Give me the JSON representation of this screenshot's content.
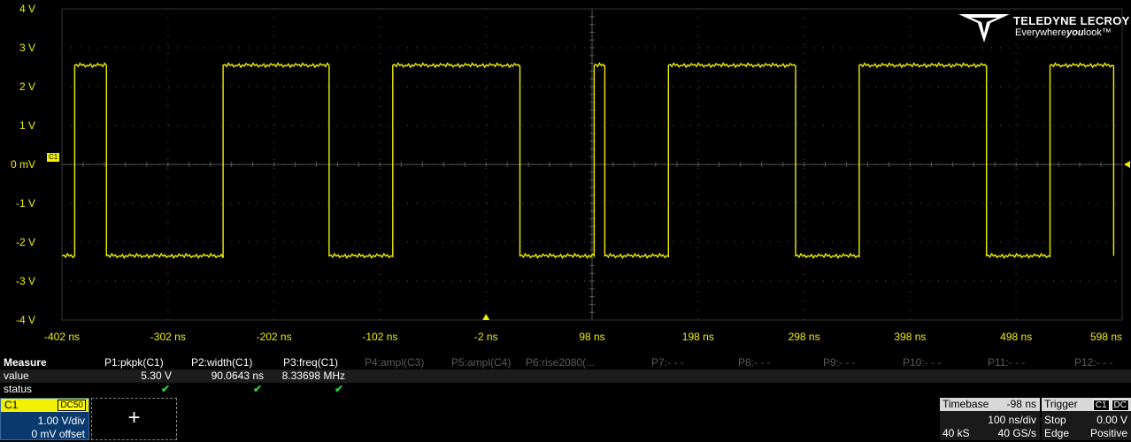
{
  "scope": {
    "y_labels": [
      "4 V",
      "3 V",
      "2 V",
      "1 V",
      "0 mV",
      "-1 V",
      "-2 V",
      "-3 V",
      "-4 V"
    ],
    "x_labels": [
      "-402 ns",
      "-302 ns",
      "-202 ns",
      "-102 ns",
      "-2 ns",
      "98 ns",
      "198 ns",
      "298 ns",
      "398 ns",
      "498 ns",
      "598 ns"
    ],
    "channel_badge": "C1",
    "trace_color": "#f0f000",
    "grid_color": "#3a3a3a"
  },
  "chart_data": {
    "type": "line",
    "xlabel": "",
    "ylabel": "",
    "xlim": [
      -402,
      598
    ],
    "ylim": [
      -4,
      4
    ],
    "grid": true,
    "series": [
      {
        "x": [
          -402,
          -390,
          -390,
          -360,
          -360,
          -250,
          -250,
          -150,
          -150,
          -90,
          -90,
          30,
          30,
          100,
          100,
          110,
          110,
          170,
          170,
          290,
          290,
          350,
          350,
          470,
          470,
          530,
          530,
          590,
          590
        ],
        "y": [
          -2.35,
          -2.35,
          2.55,
          2.55,
          -2.35,
          -2.35,
          2.55,
          2.55,
          -2.35,
          -2.35,
          2.55,
          2.55,
          -2.35,
          -2.35,
          2.55,
          2.55,
          -2.35,
          -2.35,
          2.55,
          2.55,
          -2.35,
          -2.35,
          2.55,
          2.55,
          -2.35,
          -2.35,
          2.55,
          2.55,
          -2.35
        ]
      }
    ]
  },
  "logo": {
    "brand": "TELEDYNE LECROY",
    "tag_pre": "Everywhere",
    "tag_bold": "you",
    "tag_post": "look™"
  },
  "measure": {
    "title": "Measure",
    "row_value_label": "value",
    "row_status_label": "status",
    "params": [
      {
        "name": "P1:pkpk(C1)",
        "value": "5.30 V",
        "status": "✔",
        "active": true
      },
      {
        "name": "P2:width(C1)",
        "value": "90.0643 ns",
        "status": "✔",
        "active": true
      },
      {
        "name": "P3:freq(C1)",
        "value": "8.33698 MHz",
        "status": "✔",
        "active": true
      },
      {
        "name": "P4:ampl(C3)",
        "value": "",
        "status": "",
        "active": false
      },
      {
        "name": "P5:ampl(C4)",
        "value": "",
        "status": "",
        "active": false
      },
      {
        "name": "P6:rise2080(...",
        "value": "",
        "status": "",
        "active": false
      },
      {
        "name": "P7:- - -",
        "value": "",
        "status": "",
        "active": false
      },
      {
        "name": "P8:- - -",
        "value": "",
        "status": "",
        "active": false
      },
      {
        "name": "P9:- - -",
        "value": "",
        "status": "",
        "active": false
      },
      {
        "name": "P10:- - -",
        "value": "",
        "status": "",
        "active": false
      },
      {
        "name": "P11:- - -",
        "value": "",
        "status": "",
        "active": false
      },
      {
        "name": "P12:- - -",
        "value": "",
        "status": "",
        "active": false
      }
    ]
  },
  "channel": {
    "name": "C1",
    "coupling": "DC50",
    "scale": "1.00 V/div",
    "offset": "0 mV offset"
  },
  "add_button": "+",
  "timebase": {
    "title": "Timebase",
    "delay": "-98 ns",
    "scale": "100 ns/div",
    "samples": "40 kS",
    "rate": "40 GS/s"
  },
  "trigger": {
    "title": "Trigger",
    "src": "C1",
    "coupling": "DC",
    "mode": "Stop",
    "level": "0.00 V",
    "type": "Edge",
    "slope": "Positive"
  }
}
